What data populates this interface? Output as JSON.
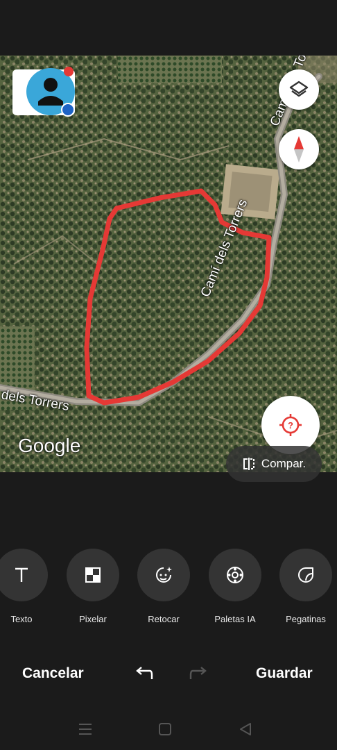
{
  "map": {
    "road_label_left": "dels Torrers",
    "road_label_diag": "Camí dels Torrers",
    "road_label_top": "Camí dels Torrers",
    "google_logo": "Google",
    "compare_label": "Compar."
  },
  "tools": [
    {
      "label": "Texto",
      "icon": "text-icon"
    },
    {
      "label": "Pixelar",
      "icon": "pixelate-icon"
    },
    {
      "label": "Retocar",
      "icon": "retouch-icon"
    },
    {
      "label": "Paletas IA",
      "icon": "palette-icon"
    },
    {
      "label": "Pegatinas",
      "icon": "sticker-icon"
    }
  ],
  "actions": {
    "cancel": "Cancelar",
    "save": "Guardar"
  },
  "colors": {
    "background": "#1b1b1b",
    "tool_circle": "#343434",
    "drawn_path": "#e53935",
    "avatar": "#3aa7d9"
  }
}
